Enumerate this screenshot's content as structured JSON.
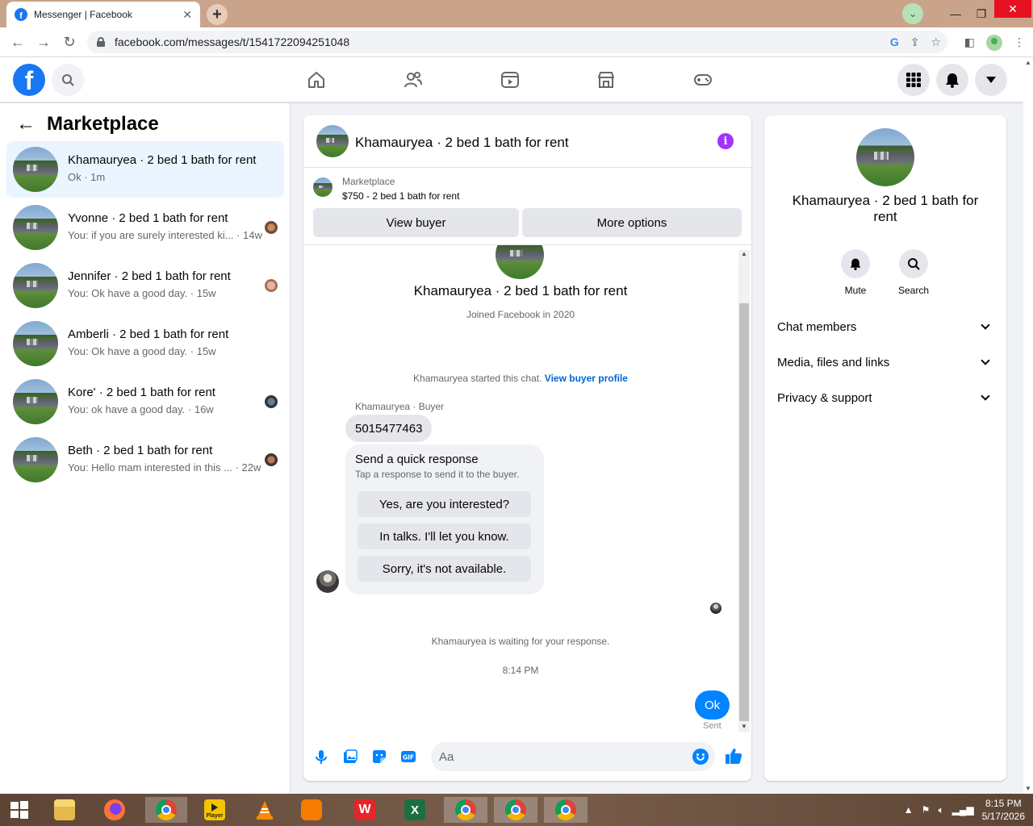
{
  "browser": {
    "tab_title": "Messenger | Facebook",
    "url": "facebook.com/messages/t/1541722094251048"
  },
  "left": {
    "title": "Marketplace",
    "conversations": [
      {
        "name": "Khamauryea · 2 bed 1 bath for rent",
        "sub": "Ok · 1m",
        "active": true
      },
      {
        "name": "Yvonne · 2 bed 1 bath for rent",
        "sub": "You: if you are surely interested ki... · 14w"
      },
      {
        "name": "Jennifer · 2 bed 1 bath for rent",
        "sub": "You: Ok have a good day. · 15w"
      },
      {
        "name": "Amberli · 2 bed 1 bath for rent",
        "sub": "You: Ok have a good day. · 15w"
      },
      {
        "name": "Kore' · 2 bed 1 bath for rent",
        "sub": "You: ok have a good day. · 16w"
      },
      {
        "name": "Beth · 2 bed 1 bath for rent",
        "sub": "You: Hello mam interested in this ... · 22w"
      }
    ]
  },
  "chat": {
    "title": "Khamauryea · 2 bed 1 bath for rent",
    "listing": {
      "source": "Marketplace",
      "price_title": "$750 - 2 bed 1 bath for rent",
      "view_buyer": "View buyer",
      "more_options": "More options"
    },
    "profile_name": "Khamauryea · 2 bed 1 bath for rent",
    "joined": "Joined Facebook in 2020",
    "started_text": "Khamauryea started this chat.",
    "view_profile": "View buyer profile",
    "sender_label": "Khamauryea · Buyer",
    "phone": "5015477463",
    "quick": {
      "title": "Send a quick response",
      "subtitle": "Tap a response to send it to the buyer.",
      "options": [
        "Yes, are you interested?",
        "In talks. I'll let you know.",
        "Sorry, it's not available."
      ]
    },
    "waiting": "Khamauryea is waiting for your response.",
    "timestamp": "8:14 PM",
    "my_message": "Ok",
    "status": "Sent",
    "composer_placeholder": "Aa"
  },
  "right": {
    "name": "Khamauryea · 2 bed 1 bath for rent",
    "mute": "Mute",
    "search": "Search",
    "sections": [
      "Chat members",
      "Media, files and links",
      "Privacy & support"
    ]
  },
  "taskbar": {
    "time": "8:15 PM",
    "date": "5/17/2026",
    "player_label": "Player"
  },
  "colors": {
    "facebook_blue": "#1877f2",
    "messenger_blue": "#0084ff",
    "info_purple": "#a033ff"
  }
}
